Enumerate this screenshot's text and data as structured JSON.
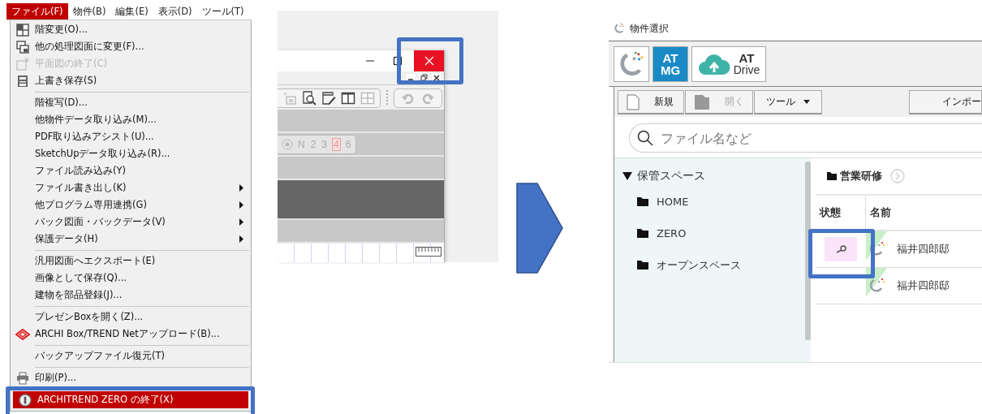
{
  "menu_bar": [
    {
      "label": "ファイル(F)",
      "selected": true
    },
    {
      "label": "物件(B)",
      "selected": false
    },
    {
      "label": "編集(E)",
      "selected": false
    },
    {
      "label": "表示(D)",
      "selected": false
    },
    {
      "label": "ツール(T)",
      "selected": false
    }
  ],
  "file_menu": {
    "sections": [
      [
        {
          "label": "階変更(O)...",
          "disabled": false,
          "submenu": false,
          "highlighted": false
        },
        {
          "label": "他の処理図面に変更(F)...",
          "disabled": false,
          "submenu": false,
          "highlighted": false
        },
        {
          "label": "平面図の終了(C)",
          "disabled": true,
          "submenu": false,
          "highlighted": false
        },
        {
          "label": "上書き保存(S)",
          "disabled": false,
          "submenu": false,
          "highlighted": false
        }
      ],
      [
        {
          "label": "階複写(D)...",
          "disabled": false,
          "submenu": false,
          "highlighted": false
        },
        {
          "label": "他物件データ取り込み(M)...",
          "disabled": false,
          "submenu": false,
          "highlighted": false
        },
        {
          "label": "PDF取り込みアシスト(U)...",
          "disabled": false,
          "submenu": false,
          "highlighted": false
        },
        {
          "label": "SketchUpデータ取り込み(R)...",
          "disabled": false,
          "submenu": false,
          "highlighted": false
        },
        {
          "label": "ファイル読み込み(Y)",
          "disabled": false,
          "submenu": false,
          "highlighted": false
        },
        {
          "label": "ファイル書き出し(K)",
          "disabled": false,
          "submenu": true,
          "highlighted": false
        },
        {
          "label": "他プログラム専用連携(G)",
          "disabled": false,
          "submenu": true,
          "highlighted": false
        },
        {
          "label": "バック図面・バックデータ(V)",
          "disabled": false,
          "submenu": true,
          "highlighted": false
        },
        {
          "label": "保護データ(H)",
          "disabled": false,
          "submenu": true,
          "highlighted": false
        }
      ],
      [
        {
          "label": "汎用図面へエクスポート(E)",
          "disabled": false,
          "submenu": false,
          "highlighted": false
        },
        {
          "label": "画像として保存(Q)...",
          "disabled": false,
          "submenu": false,
          "highlighted": false
        },
        {
          "label": "建物を部品登録(J)...",
          "disabled": false,
          "submenu": false,
          "highlighted": false
        }
      ],
      [
        {
          "label": "プレゼンBoxを開く(Z)...",
          "disabled": false,
          "submenu": false,
          "highlighted": false
        },
        {
          "label": "ARCHI Box/TREND Netアップロード(B)...",
          "disabled": false,
          "submenu": false,
          "highlighted": false
        }
      ],
      [
        {
          "label": "バックアップファイル復元(T)",
          "disabled": false,
          "submenu": false,
          "highlighted": false
        }
      ],
      [
        {
          "label": "印刷(P)...",
          "disabled": false,
          "submenu": false,
          "highlighted": false
        }
      ],
      [
        {
          "label": "ARCHITREND ZERO の終了(X)",
          "disabled": false,
          "submenu": false,
          "highlighted": true
        }
      ]
    ]
  },
  "cad_window": {
    "floor_buttons": [
      {
        "label": "N",
        "selected": false
      },
      {
        "label": "2",
        "selected": false
      },
      {
        "label": "3",
        "selected": false
      },
      {
        "label": "4",
        "selected": true
      },
      {
        "label": "6",
        "selected": false
      }
    ]
  },
  "property_window": {
    "title": "物件選択",
    "brand_tiles": [
      {
        "kind": "logo"
      },
      {
        "kind": "atmg",
        "lines": [
          "AT",
          "MG"
        ]
      },
      {
        "kind": "atdrive",
        "lines": [
          "AT",
          "Drive"
        ]
      }
    ],
    "toolbar": [
      {
        "kind": "new",
        "label": "新規",
        "disabled": false
      },
      {
        "kind": "open",
        "label": "開く",
        "disabled": true
      },
      {
        "kind": "dropdown",
        "label": "ツール",
        "disabled": false
      },
      {
        "kind": "plain",
        "label": "インポー",
        "disabled": false
      }
    ],
    "search": {
      "placeholder": "ファイル名など"
    },
    "tree": [
      {
        "label": "保管スペース",
        "expanded": true,
        "children": [
          {
            "label": "HOME"
          },
          {
            "label": "ZERO"
          },
          {
            "label": "オープンスペース"
          }
        ]
      }
    ],
    "breadcrumb": "営業研修",
    "table": {
      "columns": [
        "状態",
        "名前"
      ],
      "rows": [
        {
          "locked": true,
          "name": "福井四郎邸"
        },
        {
          "locked": false,
          "name": "福井四郎邸"
        }
      ]
    }
  }
}
